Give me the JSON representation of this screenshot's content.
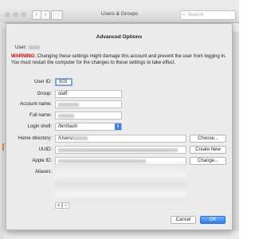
{
  "window": {
    "title": "Users & Groups",
    "search_placeholder": "Search",
    "back_label": "‹",
    "forward_label": "›",
    "grid_label": "⋮⋮⋮"
  },
  "sheet": {
    "title": "Advanced Options",
    "user_label": "User:",
    "warning_label": "WARNING:",
    "warning_text": "Changing these settings might damage this account and prevent the user from logging in. You must restart the computer for the changes to these settings to take effect.",
    "fields": {
      "user_id_label": "User ID:",
      "user_id_value": "503",
      "group_label": "Group:",
      "group_value": "staff",
      "account_name_label": "Account name:",
      "full_name_label": "Full name:",
      "login_shell_label": "Login shell:",
      "login_shell_value": "/bin/bash",
      "home_dir_label": "Home directory:",
      "home_dir_value": "/Users/",
      "uuid_label": "UUID:",
      "apple_id_label": "Apple ID:",
      "aliases_label": "Aliases:"
    },
    "buttons": {
      "choose": "Choose...",
      "create_new": "Create New",
      "change": "Change...",
      "add": "+",
      "remove": "−",
      "cancel": "Cancel",
      "ok": "OK"
    }
  }
}
